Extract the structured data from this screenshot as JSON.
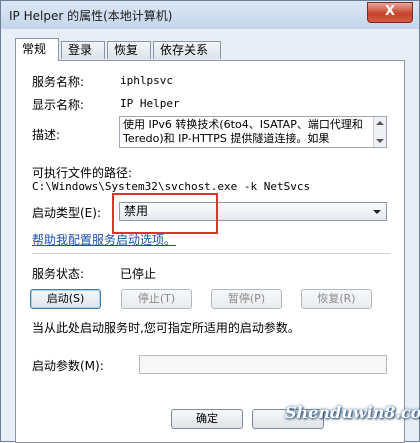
{
  "window": {
    "title": "IP Helper 的属性(本地计算机)",
    "close_glyph": "X"
  },
  "tabs": [
    "常规",
    "登录",
    "恢复",
    "依存关系"
  ],
  "general": {
    "service_name_label": "服务名称:",
    "service_name_value": "iphlpsvc",
    "display_name_label": "显示名称:",
    "display_name_value": "IP Helper",
    "description_label": "描述:",
    "description_value": "使用 IPv6 转换技术(6to4、ISATAP、端口代理和 Teredo)和 IP-HTTPS 提供隧道连接。如果",
    "exe_path_label": "可执行文件的路径:",
    "exe_path_value": "C:\\Windows\\System32\\svchost.exe -k NetSvcs",
    "startup_type_label": "启动类型(E):",
    "startup_type_value": "禁用",
    "help_link": "帮助我配置服务启动选项。",
    "service_status_label": "服务状态:",
    "service_status_value": "已停止",
    "buttons": {
      "start": "启动(S)",
      "stop": "停止(T)",
      "pause": "暂停(P)",
      "resume": "恢复(R)"
    },
    "start_hint": "当从此处启动服务时,您可指定所适用的启动参数。",
    "start_params_label": "启动参数(M):",
    "start_params_value": ""
  },
  "footer": {
    "ok_label": "确定",
    "watermark": "Shenduwin8.com"
  },
  "colors": {
    "highlight_box": "#e0312c",
    "link": "#1a4fb3",
    "close_button": "#c7432c"
  },
  "icons": {
    "close": "close-icon",
    "dropdown": "chevron-down-icon"
  }
}
